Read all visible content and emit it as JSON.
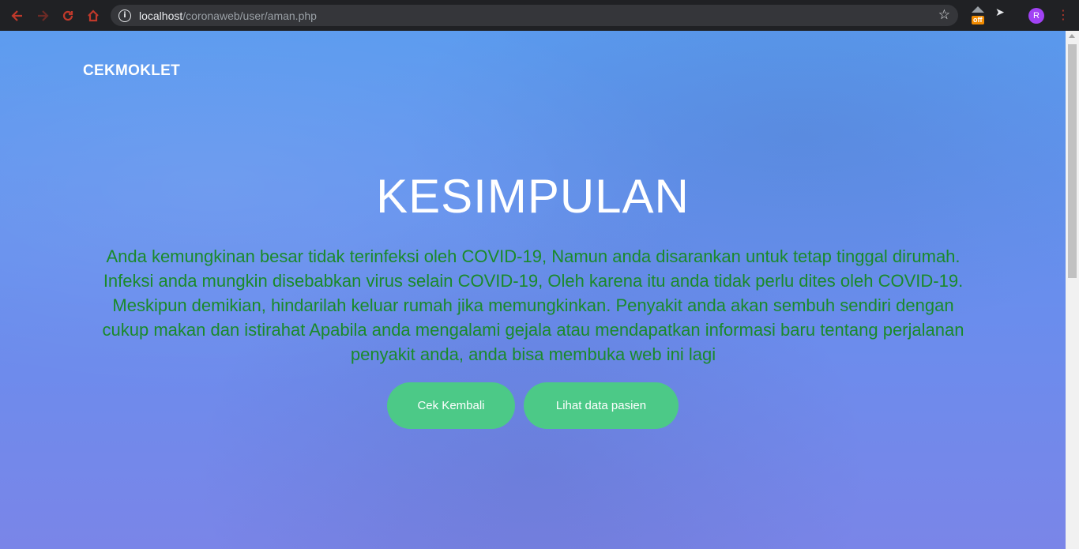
{
  "browser": {
    "url_host": "localhost",
    "url_path": "/coronaweb/user/aman.php",
    "extension_badge": "off",
    "profile_initial": "R"
  },
  "colors": {
    "brand_green": "#4cc987",
    "text_green": "#1a8a2a",
    "hero_gradient_top": "#5b9bef",
    "hero_gradient_bottom": "#7a85e8"
  },
  "navbar": {
    "brand": "CEKMOKLET"
  },
  "hero": {
    "title": "KESIMPULAN",
    "text": "Anda kemungkinan besar tidak terinfeksi oleh COVID-19, Namun anda disarankan untuk tetap tinggal dirumah. Infeksi anda mungkin disebabkan virus selain COVID-19, Oleh karena itu anda tidak perlu dites oleh COVID-19. Meskipun demikian, hindarilah keluar rumah jika memungkinkan. Penyakit anda akan sembuh sendiri dengan cukup makan dan istirahat Apabila anda mengalami gejala atau mendapatkan informasi baru tentang perjalanan penyakit anda, anda bisa membuka web ini lagi",
    "buttons": {
      "cek_kembali": "Cek Kembali",
      "lihat_data": "Lihat data pasien"
    }
  }
}
